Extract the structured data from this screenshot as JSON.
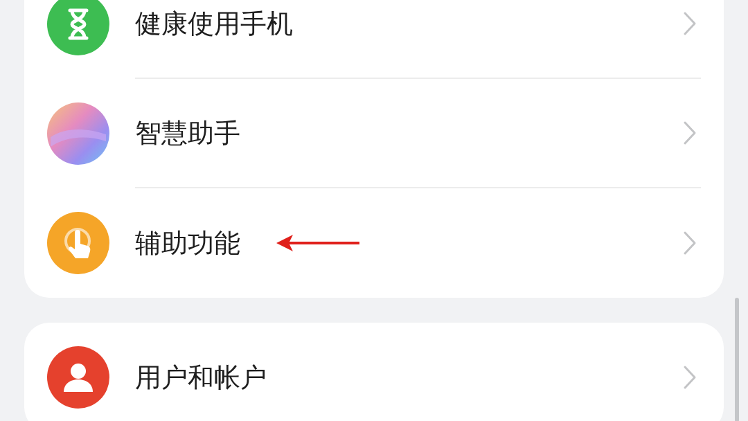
{
  "groups": [
    {
      "items": [
        {
          "label": "健康使用手机",
          "kind": "hourglass",
          "pointer": false
        },
        {
          "label": "智慧助手",
          "kind": "assistant",
          "pointer": false
        },
        {
          "label": "辅助功能",
          "kind": "accessibility",
          "pointer": true
        }
      ]
    },
    {
      "items": [
        {
          "label": "用户和帐户",
          "kind": "user",
          "pointer": false
        }
      ]
    }
  ]
}
